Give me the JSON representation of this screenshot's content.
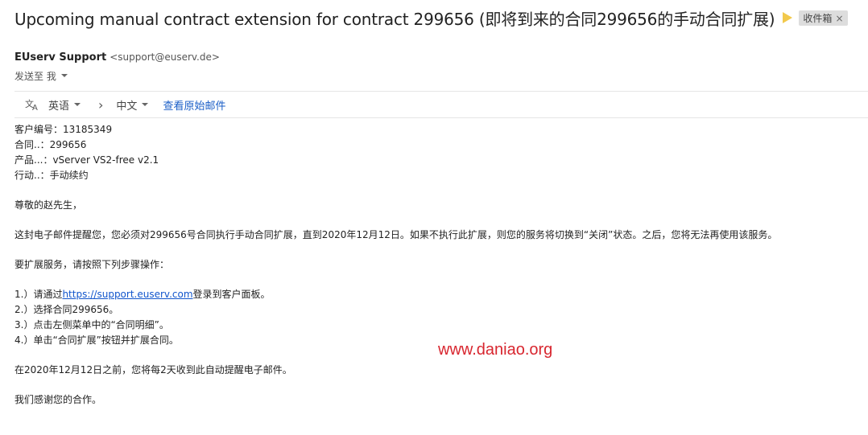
{
  "email": {
    "subject": "Upcoming manual contract extension for contract 299656 (即将到来的合同299656的手动合同扩展)",
    "label": "收件箱",
    "label_close": "×",
    "sender_name": "EUserv Support",
    "sender_email": "<support@euserv.de>",
    "recipient_text": "发送至 我"
  },
  "translate_bar": {
    "source_lang": "英语",
    "chevron": "›",
    "target_lang": "中文",
    "view_original": "查看原始邮件"
  },
  "body": {
    "customer_line": "客户编号：13185349",
    "contract_line": "合同..：299656",
    "product_line": "产品...：vServer VS2-free v2.1",
    "action_line": "行动..：手动续约",
    "greeting": "尊敬的赵先生，",
    "paragraph1": "这封电子邮件提醒您，您必须对299656号合同执行手动合同扩展，直到2020年12月12日。如果不执行此扩展，则您的服务将切换到“关闭”状态。之后，您将无法再使用该服务。",
    "paragraph2": "要扩展服务，请按照下列步骤操作：",
    "step1_prefix": "1.）请通过",
    "step1_link": "https://support.euserv.com",
    "step1_suffix": "登录到客户面板。",
    "step2": "2.）选择合同299656。",
    "step3": "3.）点击左侧菜单中的“合同明细”。",
    "step4": "4.）单击“合同扩展”按钮并扩展合同。",
    "paragraph3": "在2020年12月12日之前，您将每2天收到此自动提醒电子邮件。",
    "closing": "我们感谢您的合作。"
  },
  "watermark": "www.daniao.org",
  "colors": {
    "link": "#1155cc",
    "importance_marker": "#f2c94c",
    "watermark": "#d8262f"
  },
  "icons": {
    "translate": "translate-icon",
    "importance": "importance-marker-icon"
  }
}
